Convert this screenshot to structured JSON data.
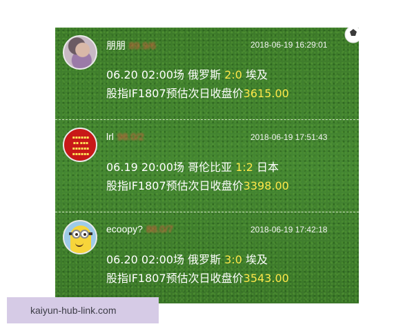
{
  "posts": [
    {
      "username": "朋朋",
      "score": "89.9/6",
      "timestamp": "2018-06-19 16:29:01",
      "match_prefix": "06.20 02:00场 俄罗斯 ",
      "match_score": "2:0",
      "match_suffix": " 埃及",
      "forecast_label": "股指IF1807预估次日收盘价",
      "forecast_value": "3615.00",
      "avatar": "photo-avatar"
    },
    {
      "username": "lrl",
      "score": "98.0/2",
      "timestamp": "2018-06-19 17:51:43",
      "match_prefix": "06.19 20:00场 哥伦比亚 ",
      "match_score": "1:2",
      "match_suffix": " 日本",
      "forecast_label": "股指IF1807预估次日收盘价",
      "forecast_value": "3398.00",
      "avatar": "red-text-avatar"
    },
    {
      "username": "ecoopy?",
      "score": "88.0/7",
      "timestamp": "2018-06-19 17:42:18",
      "match_prefix": "06.20 02:00场 俄罗斯 ",
      "match_score": "3:0",
      "match_suffix": " 埃及",
      "forecast_label": "股指IF1807预估次日收盘价",
      "forecast_value": "3543.00",
      "avatar": "minion-avatar"
    }
  ],
  "watermark": "kaiyun-hub-link.com",
  "colors": {
    "background_green": "#3f7f2c",
    "highlight_yellow": "#ffe84a",
    "score_red": "#e9573f",
    "watermark_bg": "#d6cbe6"
  }
}
